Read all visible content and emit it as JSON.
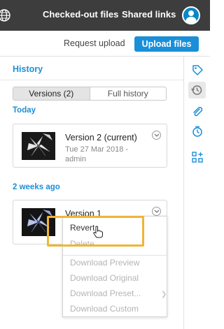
{
  "topbar": {
    "links": [
      "Checked-out files",
      "Shared links"
    ]
  },
  "actions": {
    "request_upload": "Request upload",
    "upload_files": "Upload files"
  },
  "history": {
    "title": "History",
    "tabs": [
      "Versions (2)",
      "Full history"
    ],
    "active_tab": 0
  },
  "groups": [
    {
      "label": "Today",
      "version": {
        "name": "Version 2 (current)",
        "meta": "Tue 27 Mar 2018 - admin"
      }
    },
    {
      "label": "2 weeks ago",
      "version": {
        "name": "Version 1"
      }
    }
  ],
  "context_menu": {
    "items": [
      {
        "label": "Revert",
        "enabled": true
      },
      {
        "label": "Delete",
        "enabled": false
      },
      {
        "label": "Download Preview",
        "enabled": false
      },
      {
        "label": "Download Original",
        "enabled": false
      },
      {
        "label": "Download Preset...",
        "enabled": false
      },
      {
        "label": "Download Custom",
        "enabled": false
      }
    ]
  },
  "colors": {
    "accent": "#1a8fd8",
    "topbar": "#3d3d3d",
    "highlight": "#f0b534"
  },
  "rail_icons": [
    "tag-icon",
    "history-icon",
    "attachment-icon",
    "clock-icon",
    "add-grid-icon"
  ]
}
